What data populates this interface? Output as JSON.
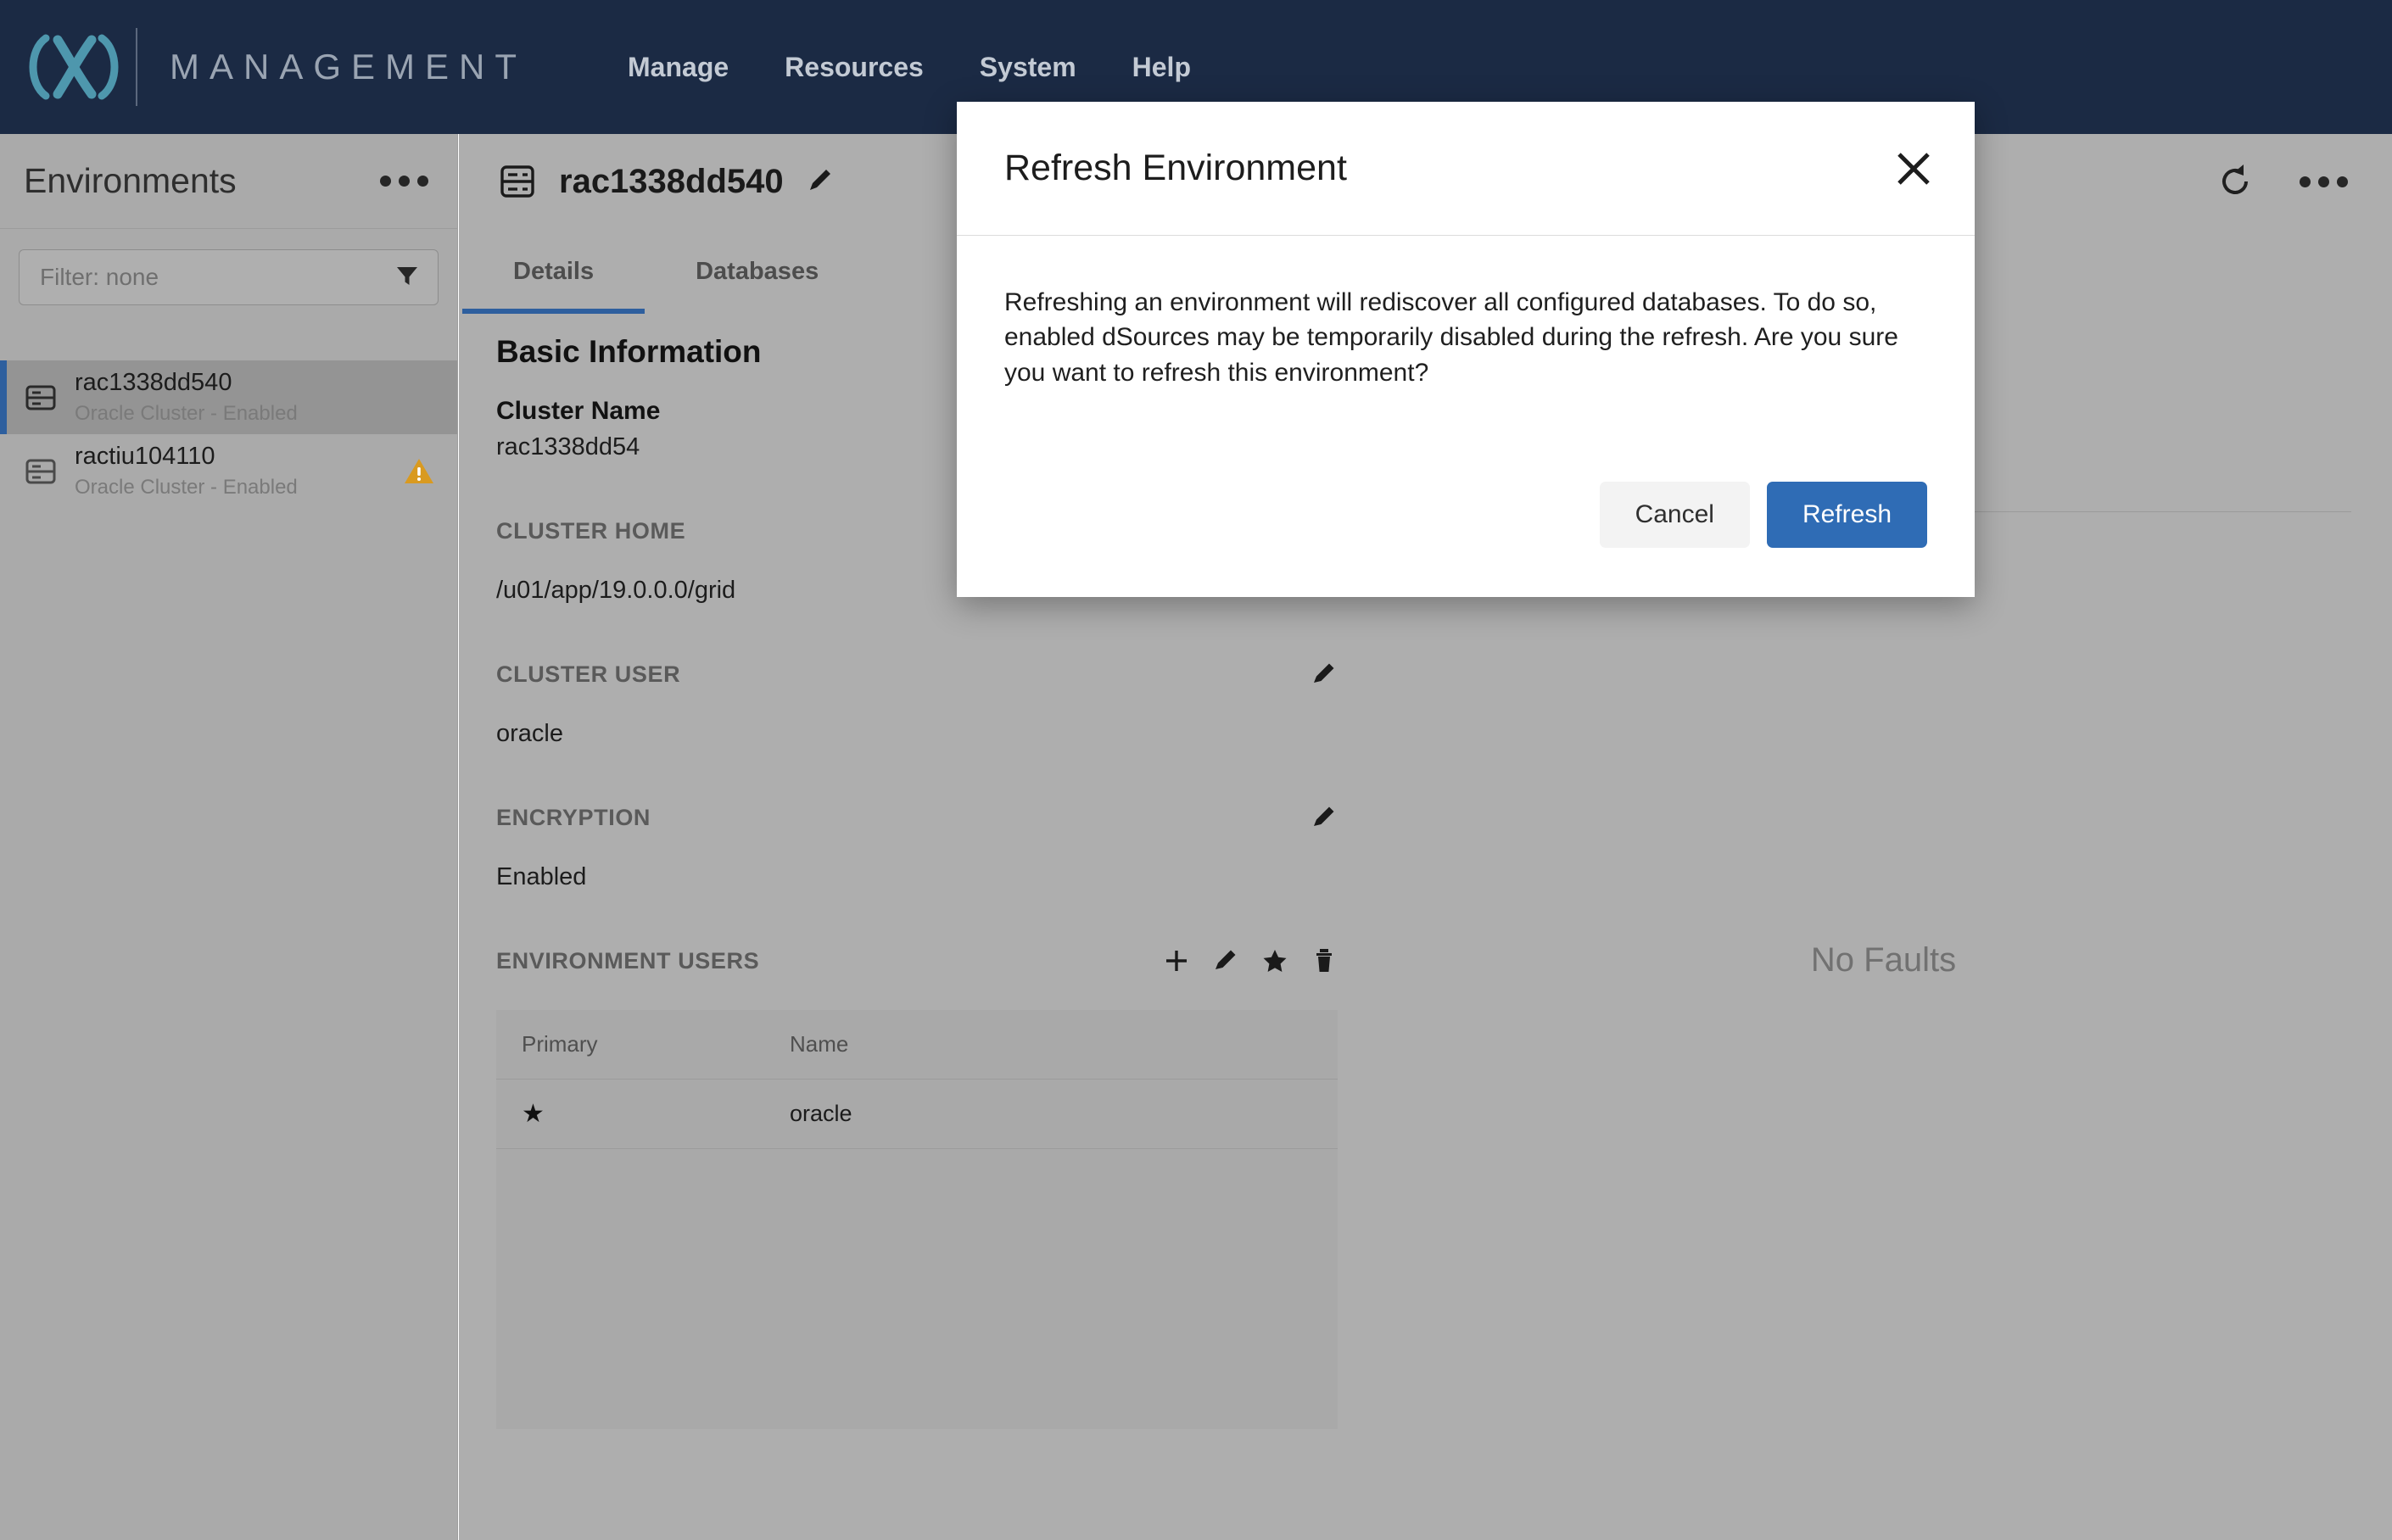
{
  "topbar": {
    "logo_icon": "delphix-logo-icon",
    "brand": "MANAGEMENT",
    "nav": [
      {
        "label": "Manage"
      },
      {
        "label": "Resources"
      },
      {
        "label": "System"
      },
      {
        "label": "Help"
      }
    ]
  },
  "sidebar": {
    "title": "Environments",
    "overflow_icon": "more-horizontal-icon",
    "filter": {
      "value": "Filter: none",
      "placeholder": "Filter: none",
      "icon": "filter-funnel-icon"
    },
    "items": [
      {
        "icon": "server-icon",
        "name": "rac1338dd540",
        "subtitle": "Oracle Cluster - Enabled",
        "selected": true,
        "warning": false
      },
      {
        "icon": "server-icon",
        "name": "ractiu104110",
        "subtitle": "Oracle Cluster - Enabled",
        "selected": false,
        "warning": true,
        "warning_icon": "warning-triangle-icon"
      }
    ]
  },
  "main": {
    "header": {
      "icon": "server-icon",
      "title": "rac1338dd540",
      "edit_icon": "pencil-icon",
      "refresh_icon": "refresh-icon",
      "overflow_icon": "more-horizontal-icon"
    },
    "tabs": [
      {
        "label": "Details",
        "active": true
      },
      {
        "label": "Databases",
        "active": false
      }
    ],
    "basic_information": {
      "heading": "Basic Information",
      "cluster_name_label": "Cluster Name",
      "cluster_name_value": "rac1338dd54"
    },
    "sections": [
      {
        "label": "CLUSTER HOME",
        "value": "/u01/app/19.0.0.0/grid",
        "actions": []
      },
      {
        "label": "CLUSTER USER",
        "value": "oracle",
        "actions": [
          {
            "icon": "pencil-icon"
          }
        ]
      },
      {
        "label": "ENCRYPTION",
        "value": "Enabled",
        "actions": [
          {
            "icon": "pencil-icon"
          }
        ]
      }
    ],
    "environment_users": {
      "label": "ENVIRONMENT USERS",
      "actions": [
        {
          "icon": "plus-icon"
        },
        {
          "icon": "pencil-icon"
        },
        {
          "icon": "star-icon"
        },
        {
          "icon": "trash-icon"
        }
      ],
      "columns": [
        "Primary",
        "Name"
      ],
      "rows": [
        {
          "primary": "★",
          "name": "oracle"
        }
      ]
    },
    "faults_panel": {
      "empty_text": "No Faults"
    }
  },
  "modal": {
    "title": "Refresh Environment",
    "close_icon": "close-x-icon",
    "message": "Refreshing an environment will rediscover all configured databases. To do so, enabled dSources may be temporarily disabled during the refresh. Are you sure you want to refresh this environment?",
    "cancel_label": "Cancel",
    "confirm_label": "Refresh"
  },
  "colors": {
    "topbar_bg": "#1b2a44",
    "accent_blue": "#2e5f9e",
    "primary_button": "#2f6cb5",
    "warning_amber": "#d99a20",
    "logo_teal": "#4e97ad"
  }
}
